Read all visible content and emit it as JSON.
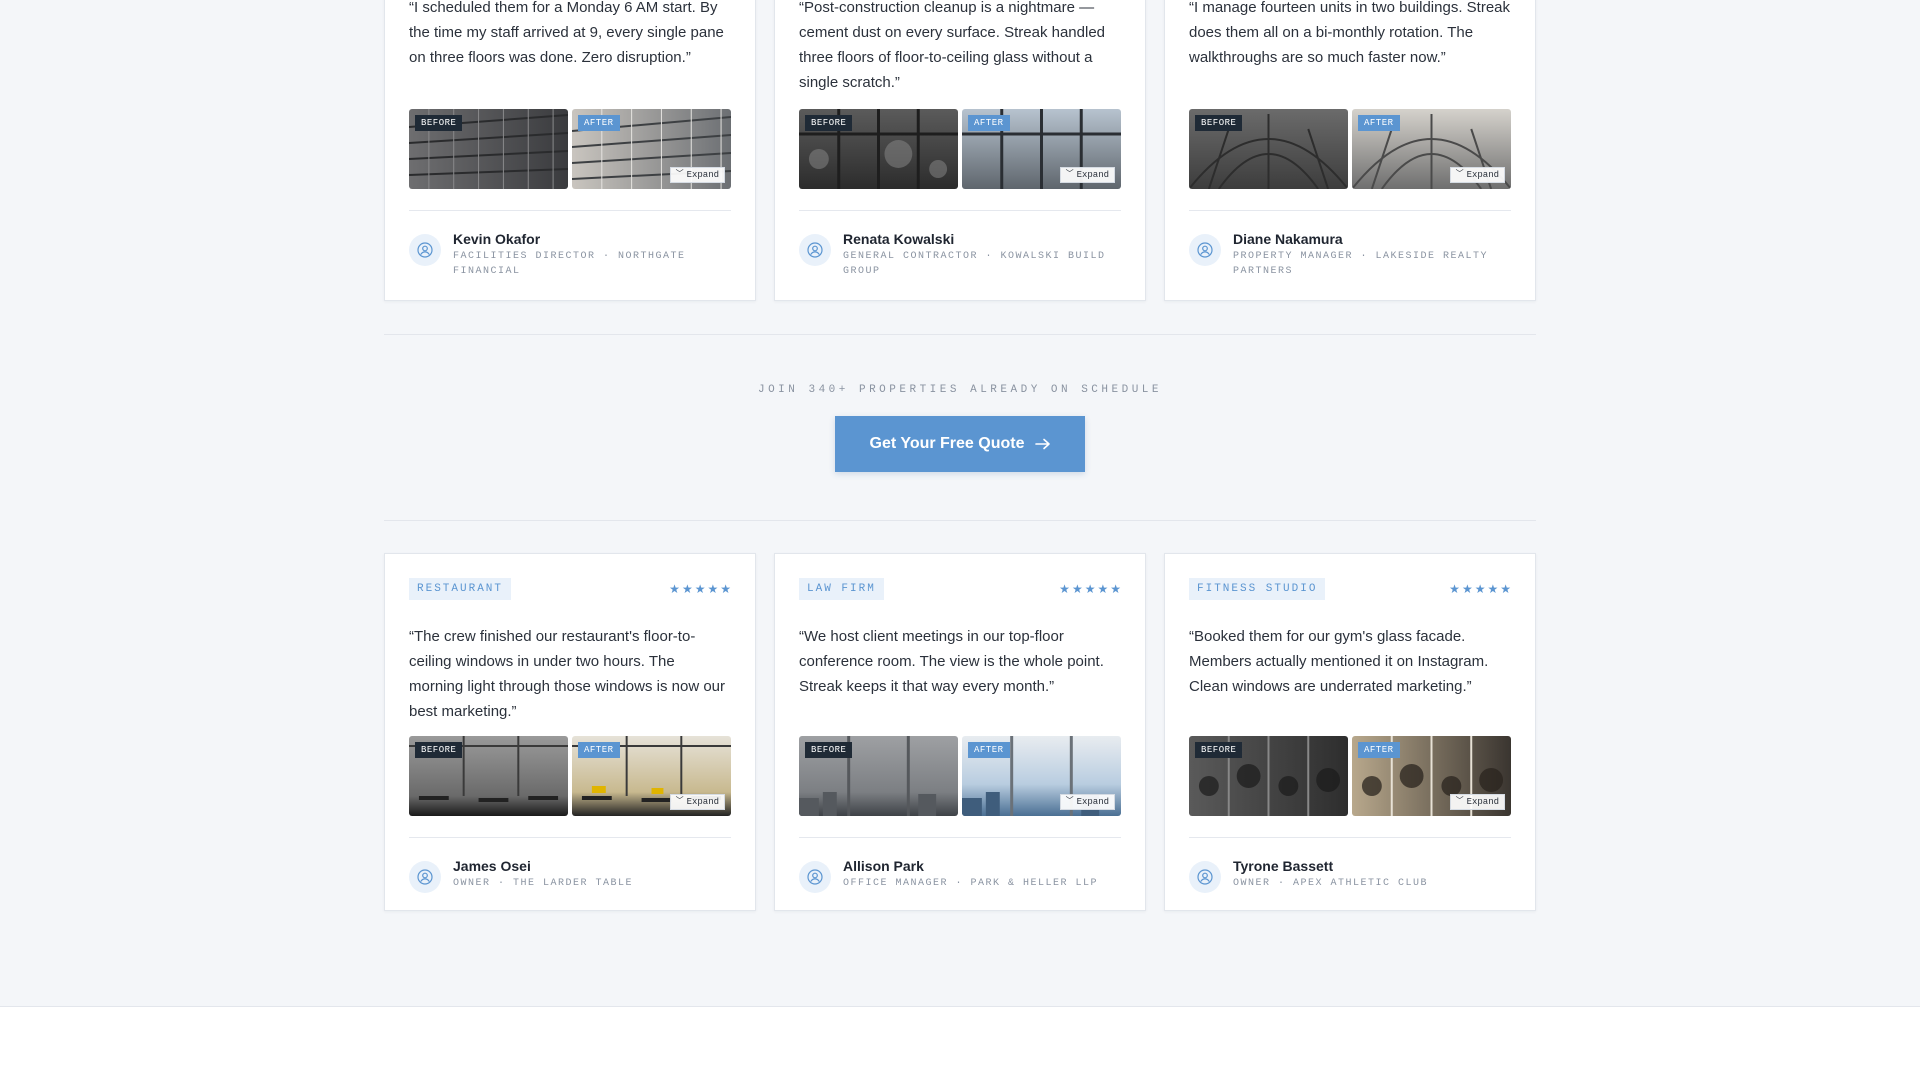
{
  "colors": {
    "accent": "#5b95d1",
    "dark_badge": "#1f2a36",
    "background": "#f4f6f9"
  },
  "photo_labels": {
    "before": "Before",
    "after": "After",
    "expand": "Expand"
  },
  "rating_icon": "star-icon",
  "top_cards": [
    {
      "quote": "“I scheduled them for a Monday 6 AM start. By the time my staff arrived at 9, every single pane on three floors was done. Zero disruption.”",
      "name": "Kevin Okafor",
      "role": "Facilities Director · Northgate Financial"
    },
    {
      "quote": "“Post-construction cleanup is a nightmare — cement dust on every surface. Streak handled three floors of floor-to-ceiling glass without a single scratch.”",
      "name": "Renata Kowalski",
      "role": "General Contractor · Kowalski Build Group"
    },
    {
      "quote": "“I manage fourteen units in two buildings. Streak does them all on a bi-monthly rotation. The walkthroughs are so much faster now.”",
      "name": "Diane Nakamura",
      "role": "Property Manager · Lakeside Realty Partners"
    }
  ],
  "cta": {
    "label": "Join 340+ properties already on schedule",
    "button": "Get Your Free Quote"
  },
  "bottom_cards": [
    {
      "tag": "Restaurant",
      "rating": 5,
      "quote": "“The crew finished our restaurant's floor-to-ceiling windows in under two hours. The morning light through those windows is now our best marketing.”",
      "name": "James Osei",
      "role": "Owner · The Larder Table"
    },
    {
      "tag": "Law Firm",
      "rating": 5,
      "quote": "“We host client meetings in our top-floor conference room. The view is the whole point. Streak keeps it that way every month.”",
      "name": "Allison Park",
      "role": "Office Manager · Park & Heller LLP"
    },
    {
      "tag": "Fitness Studio",
      "rating": 5,
      "quote": "“Booked them for our gym's glass facade. Members actually mentioned it on Instagram. Clean windows are underrated marketing.”",
      "name": "Tyrone Bassett",
      "role": "Owner · Apex Athletic Club"
    }
  ]
}
